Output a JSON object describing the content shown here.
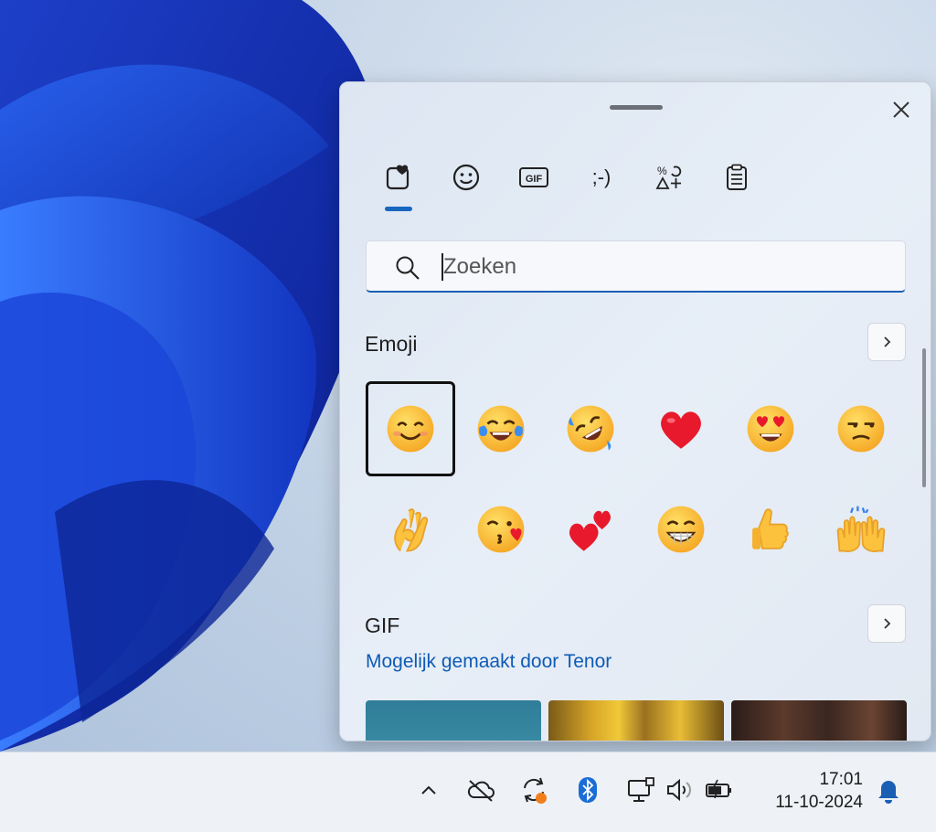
{
  "tabs": [
    {
      "name": "favorites",
      "icon": "heart-clipboard-icon"
    },
    {
      "name": "emoji",
      "icon": "smiley-icon"
    },
    {
      "name": "gif",
      "icon": "gif-icon",
      "label": "GIF"
    },
    {
      "name": "kaomoji",
      "icon": "kaomoji-icon",
      "label": ";-)"
    },
    {
      "name": "symbols",
      "icon": "symbols-icon"
    },
    {
      "name": "clipboard",
      "icon": "clipboard-icon"
    }
  ],
  "search": {
    "placeholder": "Zoeken",
    "value": ""
  },
  "emoji_section": {
    "title": "Emoji",
    "items": [
      "smiling-face-with-smiling-eyes",
      "face-with-tears-of-joy",
      "rolling-on-floor-laughing",
      "red-heart",
      "smiling-face-with-heart-eyes",
      "unamused-face",
      "ok-hand",
      "face-blowing-kiss",
      "two-hearts",
      "beaming-face-with-smiling-eyes",
      "thumbs-up",
      "raising-hands"
    ]
  },
  "gif_section": {
    "title": "GIF",
    "attribution": "Mogelijk gemaakt door Tenor"
  },
  "taskbar": {
    "time": "17:01",
    "date": "11-10-2024",
    "icons": [
      "chevron-up-icon",
      "onedrive-offline-icon",
      "sync-icon",
      "bluetooth-icon",
      "network-icon",
      "volume-icon",
      "battery-icon",
      "notification-bell-icon"
    ]
  },
  "colors": {
    "accent": "#1866c0",
    "link": "#0f5bb5"
  }
}
